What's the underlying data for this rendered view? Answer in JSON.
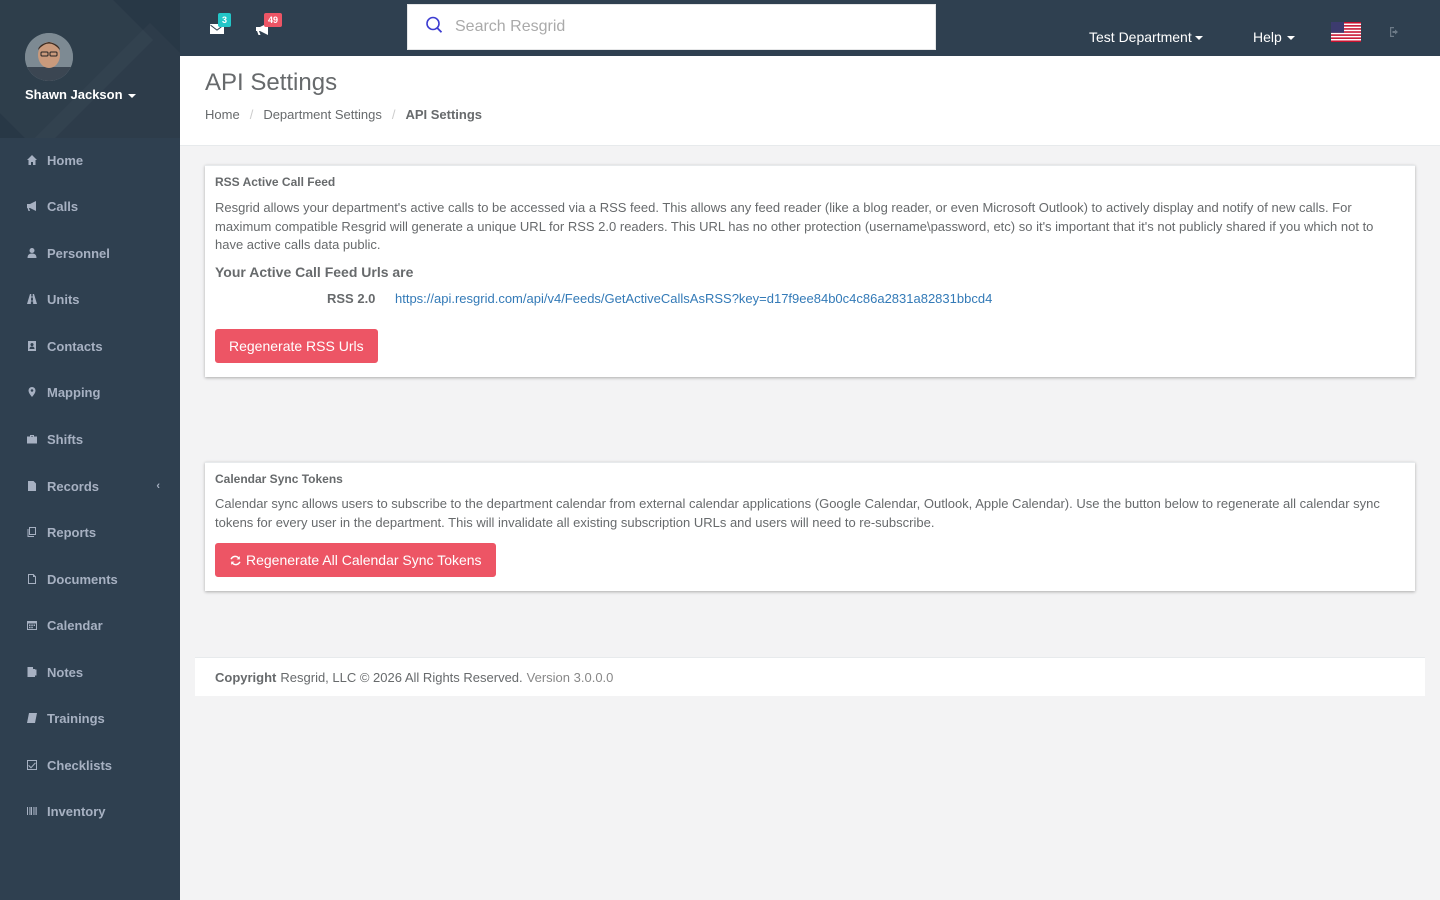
{
  "user": {
    "name": "Shawn Jackson"
  },
  "sidebar": {
    "items": [
      {
        "label": "Home",
        "icon": "home-icon"
      },
      {
        "label": "Calls",
        "icon": "bullhorn-icon"
      },
      {
        "label": "Personnel",
        "icon": "user-icon"
      },
      {
        "label": "Units",
        "icon": "road-icon"
      },
      {
        "label": "Contacts",
        "icon": "address-book-icon"
      },
      {
        "label": "Mapping",
        "icon": "map-marker-icon"
      },
      {
        "label": "Shifts",
        "icon": "briefcase-icon"
      },
      {
        "label": "Records",
        "icon": "file-icon",
        "expandable": true
      },
      {
        "label": "Reports",
        "icon": "reports-icon"
      },
      {
        "label": "Documents",
        "icon": "document-icon"
      },
      {
        "label": "Calendar",
        "icon": "calendar-icon"
      },
      {
        "label": "Notes",
        "icon": "notes-icon"
      },
      {
        "label": "Trainings",
        "icon": "book-icon"
      },
      {
        "label": "Checklists",
        "icon": "check-square-icon"
      },
      {
        "label": "Inventory",
        "icon": "barcode-icon"
      }
    ]
  },
  "topbar": {
    "messages_count": "3",
    "calls_count": "49",
    "search_placeholder": "Search Resgrid",
    "department_menu": "Test Department",
    "help_menu": "Help"
  },
  "heading": {
    "title": "API Settings",
    "breadcrumb": [
      "Home",
      "Department Settings",
      "API Settings"
    ]
  },
  "rss_panel": {
    "title": "RSS Active Call Feed",
    "description": "Resgrid allows your department's active calls to be accessed via a RSS feed. This allows any feed reader (like a blog reader, or even Microsoft Outlook) to actively display and notify of new calls. For maximum compatible Resgrid will generate a unique URL for RSS 2.0 readers. This URL has no other protection (username\\password, etc) so it's important that it's not publicly shared if you which not to have active calls data public.",
    "urls_heading": "Your Active Call Feed Urls are",
    "feed_label": "RSS 2.0",
    "feed_url": "https://api.resgrid.com/api/v4/Feeds/GetActiveCallsAsRSS?key=d17f9ee84b0c4c86a2831a82831bbcd4",
    "button_label": "Regenerate RSS Urls"
  },
  "calendar_panel": {
    "title": "Calendar Sync Tokens",
    "description": "Calendar sync allows users to subscribe to the department calendar from external calendar applications (Google Calendar, Outlook, Apple Calendar). Use the button below to regenerate all calendar sync tokens for every user in the department. This will invalidate all existing subscription URLs and users will need to re-subscribe.",
    "button_label": "Regenerate All Calendar Sync Tokens"
  },
  "footer": {
    "copyright_label": "Copyright",
    "copyright_text": "Resgrid, LLC © 2026 All Rights Reserved.",
    "version": "Version 3.0.0.0"
  },
  "colors": {
    "sidebar": "#2f4050",
    "accent_red": "#ed5565",
    "badge_teal": "#23c6c8",
    "link": "#337ab7"
  }
}
